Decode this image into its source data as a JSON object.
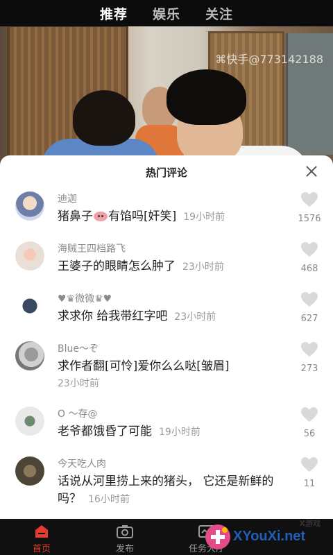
{
  "top_tabs": [
    {
      "label": "推荐",
      "active": true
    },
    {
      "label": "娱乐",
      "active": false
    },
    {
      "label": "关注",
      "active": false
    }
  ],
  "video": {
    "watermark": "快手@773142188"
  },
  "comments_panel": {
    "title": "热门评论",
    "comments": [
      {
        "username": "迪迦",
        "text_before": "猪鼻子",
        "text_after": "有馅吗[奸笑]",
        "time": "19小时前",
        "likes": "1576"
      },
      {
        "username": "海贼王四档路飞",
        "text": "王婆子的眼睛怎么肿了",
        "time": "23小时前",
        "likes": "468"
      },
      {
        "username": "♥♛微微♛♥",
        "text": "求求你 给我带红字吧",
        "time": "23小时前",
        "likes": "627"
      },
      {
        "username": "Blue～ぞ",
        "text": "求作者翻[可怜]爱你么么哒[皱眉]",
        "time": "23小时前",
        "likes": "273"
      },
      {
        "username": "O ～存@",
        "text": "老爷都饿昏了可能",
        "time": "19小时前",
        "likes": "56"
      },
      {
        "username": "今天吃人肉",
        "text": "话说从河里捞上来的猪头， 它还是新鲜的吗？",
        "time": "16小时前",
        "likes": "11"
      }
    ]
  },
  "bottom_nav": [
    {
      "label": "首页",
      "icon": "home-icon",
      "active": true
    },
    {
      "label": "发布",
      "icon": "camera-icon",
      "active": false
    },
    {
      "label": "任务大厅",
      "icon": "task-icon",
      "active": false
    }
  ],
  "brand": {
    "name": "XYouXi.net",
    "small": "X游戏"
  },
  "colors": {
    "accent": "#e63b2e",
    "heart": "#d9d9d9",
    "username": "#8a8a8a",
    "brand": "#1f5fb8"
  }
}
